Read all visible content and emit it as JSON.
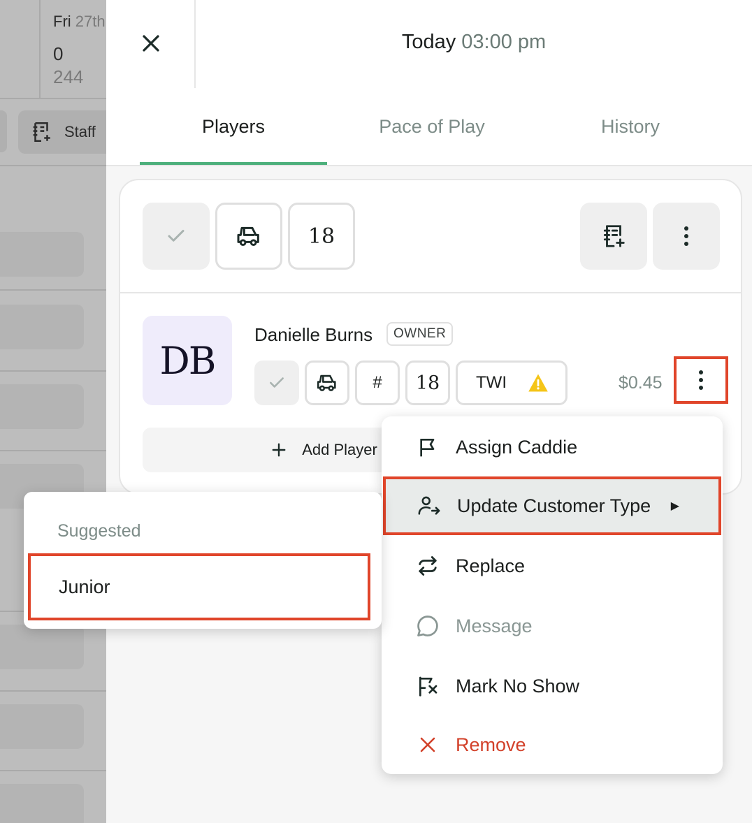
{
  "background": {
    "day_name": "Fri",
    "day_date": "27th",
    "count_primary": "0",
    "count_secondary": "244",
    "staff_label": "Staff"
  },
  "header": {
    "title_day": "Today",
    "title_time": "03:00 pm"
  },
  "tabs": [
    {
      "label": "Players",
      "active": true
    },
    {
      "label": "Pace of Play",
      "active": false
    },
    {
      "label": "History",
      "active": false
    }
  ],
  "booking": {
    "holes": "18",
    "player": {
      "initials": "DB",
      "name": "Danielle Burns",
      "role": "OWNER",
      "holes": "18",
      "number_symbol": "#",
      "customer_type": "TWI",
      "price": "$0.45"
    },
    "add_player_label": "Add Player"
  },
  "context_menu": {
    "items": [
      {
        "label": "Assign Caddie",
        "icon": "flag-icon",
        "state": "normal"
      },
      {
        "label": "Update Customer Type",
        "icon": "user-switch-icon",
        "state": "active"
      },
      {
        "label": "Replace",
        "icon": "replace-icon",
        "state": "normal"
      },
      {
        "label": "Message",
        "icon": "message-icon",
        "state": "disabled"
      },
      {
        "label": "Mark No Show",
        "icon": "flag-x-icon",
        "state": "normal"
      },
      {
        "label": "Remove",
        "icon": "x-icon",
        "state": "danger"
      }
    ]
  },
  "submenu": {
    "heading": "Suggested",
    "items": [
      "Junior"
    ]
  },
  "colors": {
    "accent_green": "#4caf7b",
    "highlight_red": "#e0452a",
    "warning_yellow": "#f5c518",
    "danger_red": "#d2412a",
    "avatar_bg": "#efecfb"
  }
}
